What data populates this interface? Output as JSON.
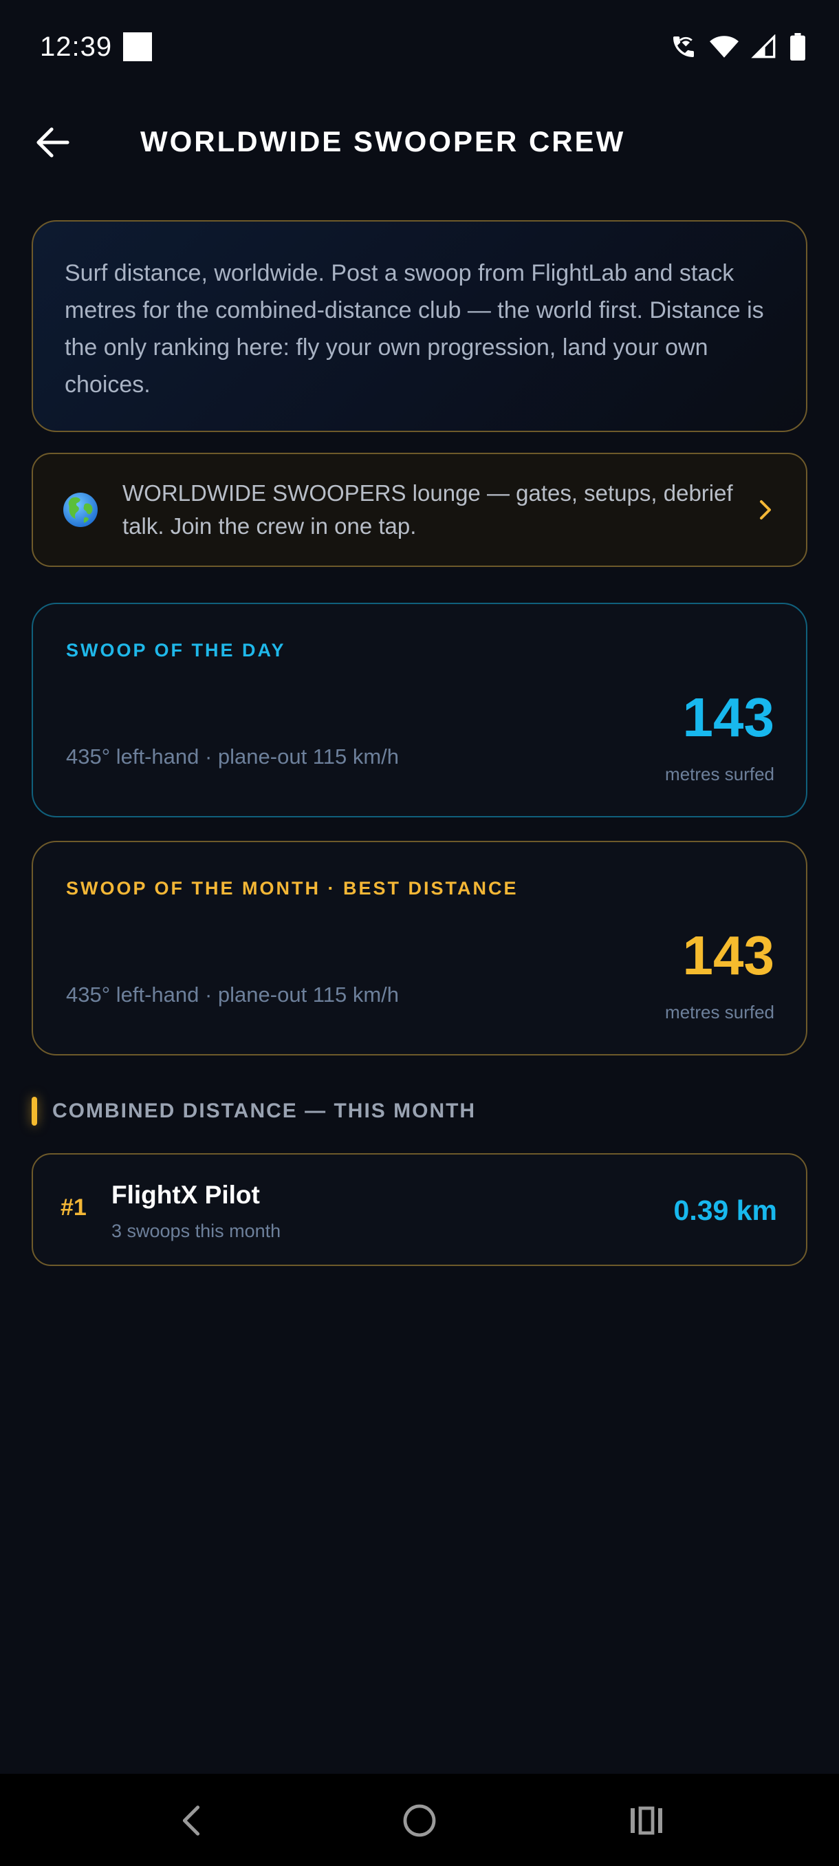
{
  "status_bar": {
    "time": "12:39",
    "icons": [
      "notification-square",
      "wifi-calling-icon",
      "wifi-icon",
      "signal-icon",
      "battery-icon"
    ]
  },
  "header": {
    "title": "WORLDWIDE SWOOPER CREW",
    "back_icon": "arrow-left-icon"
  },
  "intro": {
    "text": "Surf distance, worldwide. Post a swoop from FlightLab and stack metres for the combined-distance club — the world first. Distance is the only ranking here: fly your own progression, land your own choices."
  },
  "lounge": {
    "icon": "globe-icon",
    "text": "WORLDWIDE SWOOPERS lounge — gates, setups, debrief talk. Join the crew in one tap.",
    "chevron": "chevron-right-icon"
  },
  "swoop_of_day": {
    "label": "SWOOP OF THE DAY",
    "detail": "435° left-hand · plane-out 115 km/h",
    "value": "143",
    "unit": "metres surfed"
  },
  "swoop_of_month": {
    "label": "SWOOP OF THE MONTH · BEST DISTANCE",
    "detail": "435° left-hand · plane-out 115 km/h",
    "value": "143",
    "unit": "metres surfed"
  },
  "combined": {
    "section_title": "COMBINED DISTANCE — THIS MONTH",
    "rows": [
      {
        "rank": "#1",
        "name": "FlightX Pilot",
        "subtitle": "3 swoops this month",
        "distance": "0.39 km"
      }
    ]
  },
  "colors": {
    "background": "#0a0d15",
    "accent_blue": "#18b8ee",
    "accent_gold": "#f6bb2e",
    "border_gold": "#6e5a2a",
    "border_blue": "#10607c"
  }
}
